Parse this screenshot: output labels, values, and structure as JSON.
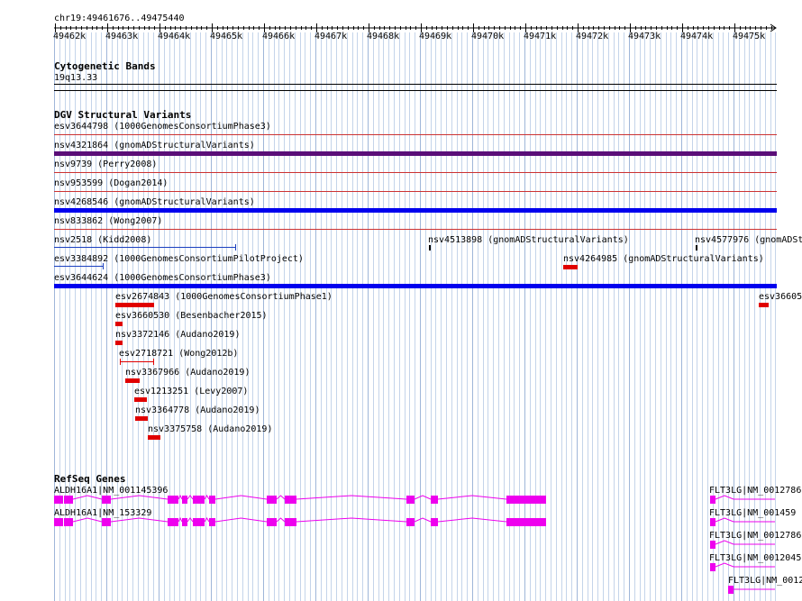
{
  "ruler": {
    "range_label": "chr19:49461676..49475440",
    "ticks": [
      "49462k",
      "49463k",
      "49464k",
      "49465k",
      "49466k",
      "49467k",
      "49468k",
      "49469k",
      "49470k",
      "49471k",
      "49472k",
      "49473k",
      "49474k",
      "49475k"
    ]
  },
  "tracks": {
    "cytoband": {
      "title": "Cytogenetic Bands",
      "band_label": "19q13.33"
    },
    "dgv": {
      "title": "DGV Structural Variants",
      "colors": {
        "deletion": "#e00000",
        "loss_line": "#cc3333",
        "gain": "#0000ee",
        "complex": "#5a0e78",
        "gain_line": "#1a3fbf"
      },
      "rows": [
        "esv3644798 (1000GenomesConsortiumPhase3)",
        "nsv4321864 (gnomADStructuralVariants)",
        "nsv9739 (Perry2008)",
        "nsv953599 (Dogan2014)",
        "nsv4268546 (gnomADStructuralVariants)",
        "nsv833862 (Wong2007)",
        "nsv2518 (Kidd2008)",
        "nsv4513898 (gnomADStructuralVariants)",
        "nsv4577976 (gnomADSt",
        "esv3384892 (1000GenomesConsortiumPilotProject)",
        "nsv4264985 (gnomADStructuralVariants)",
        "esv3644624 (1000GenomesConsortiumPhase3)",
        "esv2674843 (1000GenomesConsortiumPhase1)",
        "esv36605",
        "esv3660530 (Besenbacher2015)",
        "nsv3372146 (Audano2019)",
        "esv2718721 (Wong2012b)",
        "nsv3367966 (Audano2019)",
        "esv1213251 (Levy2007)",
        "nsv3364778 (Audano2019)",
        "nsv3375758 (Audano2019)"
      ]
    },
    "refseq": {
      "title": "RefSeq Genes",
      "color": "#ee00ee",
      "genes": [
        "ALDH16A1|NM_001145396",
        "ALDH16A1|NM_153329",
        "FLT3LG|NM_0012786",
        "FLT3LG|NM_001459",
        "FLT3LG|NM_0012786",
        "FLT3LG|NM_0012045",
        "FLT3LG|NM_0012"
      ]
    }
  }
}
